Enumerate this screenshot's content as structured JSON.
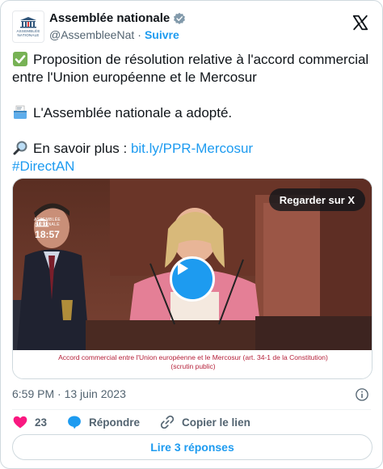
{
  "account": {
    "name": "Assemblée nationale",
    "handle": "@AssembleeNat",
    "separator": "·",
    "follow_label": "Suivre",
    "logo_text_1": "ASSEMBLÉE",
    "logo_text_2": "NATIONALE"
  },
  "tweet": {
    "line1": "Proposition de résolution relative à l'accord commercial entre l'Union européenne et le Mercosur",
    "line2": "L'Assemblée nationale a adopté.",
    "line3_prefix": "En savoir plus : ",
    "link": "bit.ly/PPR-Mercosur",
    "hashtag": "#DirectAN"
  },
  "media": {
    "watch_label": "Regarder sur X",
    "badge_small_1": "ASSEMBLÉE",
    "badge_small_2": "NATIONALE",
    "badge_time": "18:57",
    "caption_line1": "Accord commercial entre l'Union européenne et le Mercosur (art. 34-1 de la Constitution)",
    "caption_line2": "(scrutin public)"
  },
  "meta": {
    "timestamp": "6:59 PM · 13 juin 2023"
  },
  "actions": {
    "like_count": "23",
    "reply_label": "Répondre",
    "copy_label": "Copier le lien"
  },
  "replies": {
    "label": "Lire 3 réponses"
  },
  "colors": {
    "accent": "#1d9bf0",
    "like": "#f91880",
    "caption": "#b5213a"
  },
  "icons": [
    "verified-badge-icon",
    "x-logo-icon",
    "check-mark-emoji",
    "ballot-box-emoji",
    "magnifier-emoji",
    "play-icon",
    "info-icon",
    "heart-icon",
    "reply-bubble-icon",
    "link-icon"
  ]
}
